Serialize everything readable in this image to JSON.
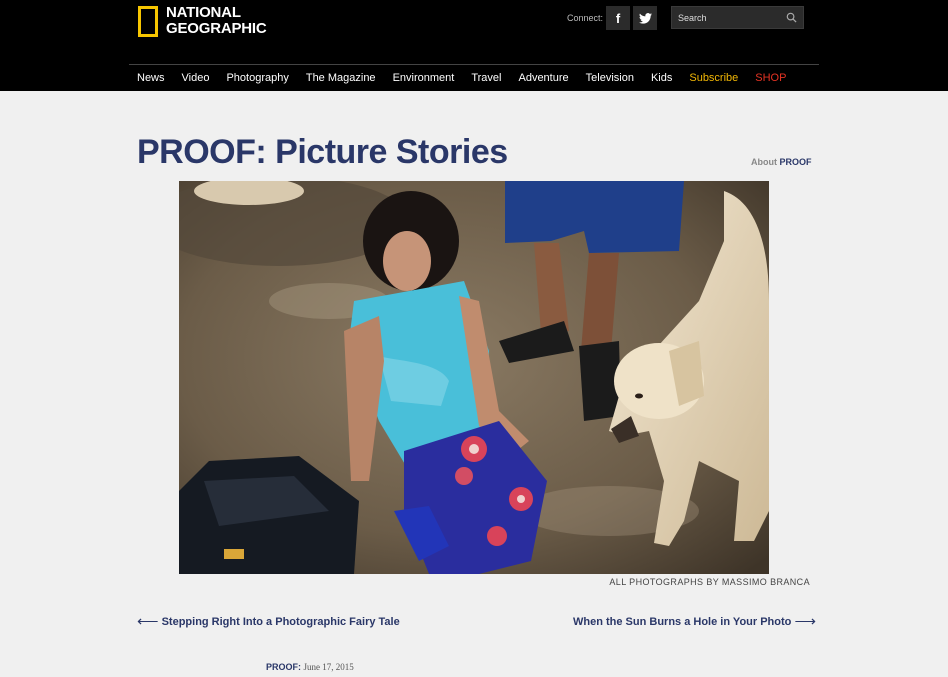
{
  "header": {
    "logo_line1": "NATIONAL",
    "logo_line2": "GEOGRAPHIC",
    "connect_label": "Connect:",
    "social": [
      "f",
      "t"
    ],
    "search_placeholder": "Search"
  },
  "nav": {
    "items": [
      "News",
      "Video",
      "Photography",
      "The Magazine",
      "Environment",
      "Travel",
      "Adventure",
      "Television",
      "Kids"
    ],
    "subscribe": "Subscribe",
    "shop": "SHOP",
    "subscribe_color": "#f2b705",
    "shop_color": "#e53323"
  },
  "page": {
    "title": "PROOF: Picture Stories",
    "about_prefix": "About",
    "about_link": "PROOF",
    "credit": "ALL PHOTOGRAPHS BY MASSIMO BRANCA",
    "prev_label": "Stepping Right Into a Photographic Fairy Tale",
    "next_label": "When the Sun Burns a Hole in Your Photo",
    "dateline_label": "PROOF:",
    "dateline_date": "June 17, 2015"
  },
  "colors": {
    "brand_yellow": "#f7c600",
    "title_blue": "#2a3768"
  }
}
